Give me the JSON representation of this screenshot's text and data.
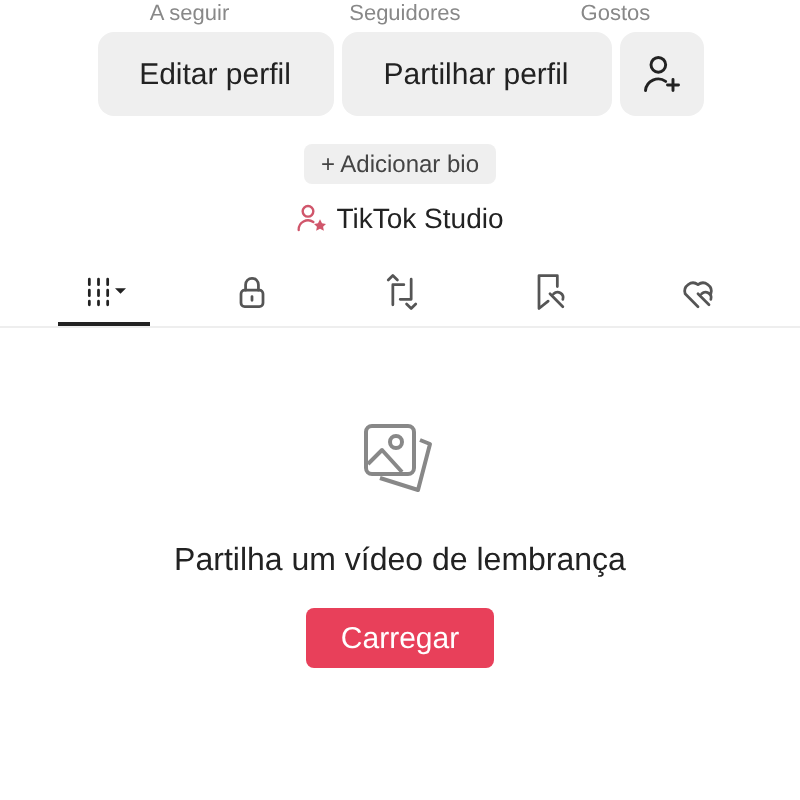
{
  "stats": [
    "A seguir",
    "Seguidores",
    "Gostos"
  ],
  "buttons": {
    "edit": "Editar perfil",
    "share": "Partilhar perfil"
  },
  "bio_button": "+ Adicionar bio",
  "studio_link": "TikTok Studio",
  "tabs": [
    {
      "kind": "grid",
      "selected": true
    },
    {
      "kind": "lock",
      "selected": false
    },
    {
      "kind": "repost",
      "selected": false
    },
    {
      "kind": "bookmark",
      "selected": false
    },
    {
      "kind": "heart",
      "selected": false
    }
  ],
  "empty": {
    "message": "Partilha um vídeo de lembrança",
    "button": "Carregar"
  }
}
